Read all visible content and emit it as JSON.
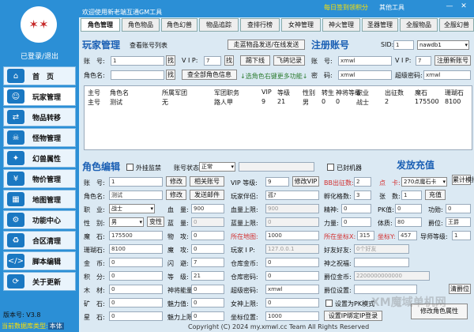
{
  "app": {
    "title": "欢迎使用新老端互通GM工具",
    "checkin": "每日签到领积分",
    "other_tools": "其他工具",
    "minimize": "—",
    "close": "✕",
    "login_status": "已登录/退出",
    "version": "版本号: V3.8",
    "db_type_label": "当前数据库类型:",
    "db_type_value": "本体",
    "footer": "Copyright (C) 2024 my.xmwl.cc Team All Rights Reserved",
    "watermark": "XM魔域单机网"
  },
  "sidebar": [
    {
      "label": "首　页",
      "icon": "⌂",
      "icon_name": "home-icon"
    },
    {
      "label": "玩家管理",
      "icon": "☺",
      "icon_name": "user-icon"
    },
    {
      "label": "物品转移",
      "icon": "⇄",
      "icon_name": "transfer-icon"
    },
    {
      "label": "怪物管理",
      "icon": "☠",
      "icon_name": "monster-icon"
    },
    {
      "label": "幻兽属性",
      "icon": "✦",
      "icon_name": "pet-icon"
    },
    {
      "label": "物价管理",
      "icon": "¥",
      "icon_name": "price-icon"
    },
    {
      "label": "地图管理",
      "icon": "▦",
      "icon_name": "map-icon"
    },
    {
      "label": "功能中心",
      "icon": "⚙",
      "icon_name": "gear-icon"
    },
    {
      "label": "合区清理",
      "icon": "♻",
      "icon_name": "clean-icon"
    },
    {
      "label": "脚本编辑",
      "icon": "</>",
      "icon_name": "code-icon"
    },
    {
      "label": "关于更新",
      "icon": "⟳",
      "icon_name": "update-icon"
    }
  ],
  "tabs": [
    "角色管理",
    "角色物品",
    "角色幻兽",
    "物品追踪",
    "查排行榜",
    "女神管理",
    "神火管理",
    "圣器管理",
    "全服物品",
    "全服幻兽"
  ],
  "player_mgmt": {
    "title": "玩家管理",
    "view_list": "查看账号列表",
    "send_items_btn": "走蓝物品发送/在线发送",
    "account_label": "账　号:",
    "account_value": "1",
    "find1": "找",
    "vip_label": "V I P:",
    "vip_value": "7",
    "find2": "找",
    "kick_btn": "踢下线",
    "record_btn": "飞鸽记录",
    "rolename_label": "角色名:",
    "find3": "找",
    "query_all_btn": "查全部角色信息",
    "hint": "↓选角色右键更多功能↓"
  },
  "register": {
    "title": "注册账号",
    "sid_label": "SID:",
    "sid_value": "1",
    "db_select": "nawdb1",
    "account_label": "账　号:",
    "account_value": "xmwl",
    "vip_label": "V I P:",
    "vip_value": "7",
    "register_btn": "注册新账号",
    "password_label": "密　码:",
    "password_value": "xmwl",
    "super_password_label": "超级密码:",
    "super_password_value": "xmwl"
  },
  "table": {
    "headers": [
      "主号",
      "角色名",
      "所属军团",
      "军团职务",
      "VIP",
      "等级",
      "性别",
      "转生",
      "神将等级",
      "职业",
      "出征数",
      "魔石",
      "珊瑚石"
    ],
    "rows": [
      [
        "主号",
        "测试",
        "无",
        "路人甲",
        "9",
        "21",
        "男",
        "0",
        "0",
        "战士",
        "2",
        "175500",
        "8100"
      ]
    ]
  },
  "role_edit": {
    "title": "角色编辑",
    "plugin_label": "外挂监禁",
    "status_label": "账号状态:",
    "status_value": "正常",
    "bot_label": "已封机器",
    "account_label": "账　号:",
    "account_value": "1",
    "modify1": "修改",
    "related_btn": "相关账号",
    "vip_label": "VIP 等级:",
    "vip_value": "9",
    "modify_vip": "修改VIP",
    "name_label": "角色名:",
    "name_value": "测试",
    "modify2": "修改",
    "send_mail": "发送邮件",
    "spouse_label": "玩家伴侣:",
    "spouse_value": "孤?",
    "job_label": "职　业:",
    "job_value": "战士",
    "hp_label": "血　量:",
    "hp_value": "900",
    "hp_max_label": "血量上限:",
    "hp_max_value": "900",
    "gender_label": "性　别:",
    "gender_value": "男",
    "change_gender": "变性",
    "mp_label": "蓝　量:",
    "mp_value": "0",
    "mp_max_label": "蓝量上限:",
    "mp_max_value": "0",
    "magic_label": "魔　石:",
    "magic_value": "175500",
    "atk_label": "物　攻:",
    "atk_value": "0",
    "map_label": "所在地图:",
    "map_value": "1000",
    "coral_label": "珊瑚石:",
    "coral_value": "8100",
    "matk_label": "魔　攻:",
    "matk_value": "0",
    "ip_label": "玩家 I P:",
    "ip_value": "127.0.0.1",
    "gold_label": "金　币:",
    "gold_value": "0",
    "dodge_label": "闪　避:",
    "dodge_value": "7",
    "wh_gold_label": "仓库金币:",
    "wh_gold_value": "0",
    "points_label": "积　分:",
    "points_value": "0",
    "level_label": "等　级:",
    "level_value": "21",
    "wh_pwd_label": "仓库密码:",
    "wh_pwd_value": "0",
    "wood_label": "木　材:",
    "wood_value": "0",
    "gp_label": "神将能量:",
    "gp_value": "0",
    "super_pwd_label": "超级密码:",
    "super_pwd_value": "xmwl",
    "ore_label": "矿　石:",
    "ore_value": "0",
    "charm_label": "魅力值:",
    "charm_value": "0",
    "goddess_label": "女神上限:",
    "goddess_value": "0",
    "star_label": "星　石:",
    "star_value": "0",
    "charm2_label": "魅力上限:",
    "charm2_value": "0",
    "pos_label": "坐标位置:",
    "pos_value": "1000"
  },
  "boost": {
    "title": "发放充值",
    "bb_label": "BB出征数:",
    "bb_value": "2",
    "card_label": "点　卡:",
    "card_value": "270点魔石卡",
    "recharge_sim": "累计模拟充值",
    "hatch_label": "孵化格数:",
    "hatch_value": "3",
    "sheets_label": "张　数:",
    "sheets_value": "1",
    "recharge_btn": "充值",
    "spirit_label": "精神:",
    "spirit_value": "0",
    "pk_label": "PK值:",
    "pk_value": "0",
    "merit_label": "功勋:",
    "merit_value": "0",
    "power_label": "力量:",
    "power_value": "0",
    "phys_label": "体质:",
    "phys_value": "80",
    "title_label": "爵位:",
    "title_value": "王爵",
    "coord_label": "所在坐标X:",
    "coord_x": "315",
    "coord_y_label": "坐标Y:",
    "coord_y": "457",
    "tutor_label": "导师等级:",
    "tutor_value": "1",
    "friend_label": "好友好友:",
    "friend_value": "0个好友",
    "deity_label": "神之祝福:",
    "deity_value": "",
    "deity2_label": "爵位金币:",
    "deity2_value": "2200000000000",
    "deity3_label": "爵位设置:",
    "deity3_value": "",
    "clear_btn": "清爵位",
    "pk_mode_label": "设置为PK模式",
    "set_ip_btn": "设置IP绑定IP登录",
    "modify_btn": "修改角色属性"
  }
}
